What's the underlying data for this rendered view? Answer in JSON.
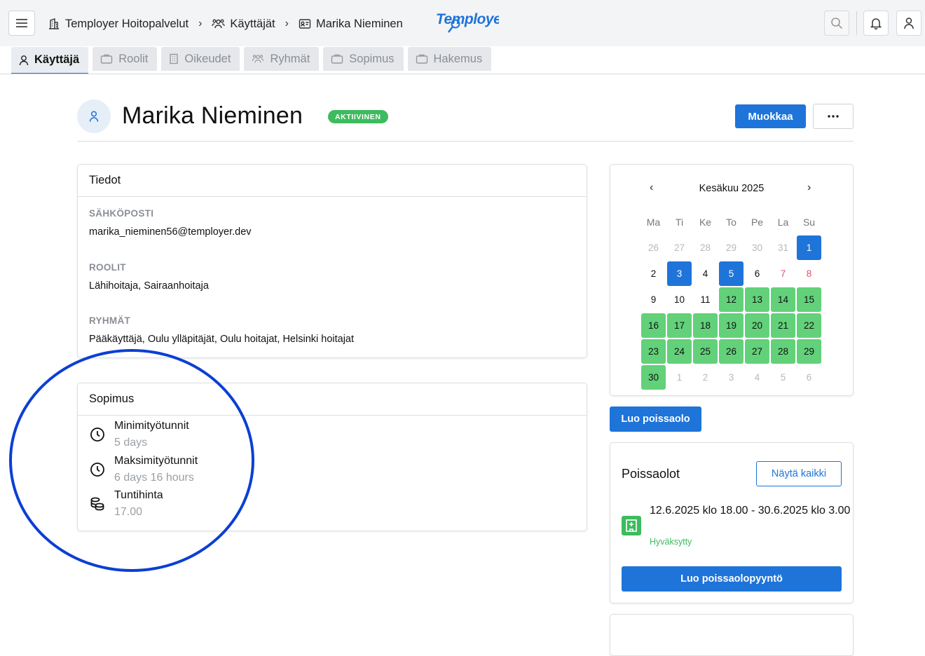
{
  "header": {
    "breadcrumbs": [
      "Temployer Hoitopalvelut",
      "Käyttäjät",
      "Marika Nieminen"
    ],
    "logo_text": "Temployer"
  },
  "tabs": [
    {
      "label": "Käyttäjä",
      "active": true
    },
    {
      "label": "Roolit"
    },
    {
      "label": "Oikeudet"
    },
    {
      "label": "Ryhmät"
    },
    {
      "label": "Sopimus"
    },
    {
      "label": "Hakemus"
    }
  ],
  "profile": {
    "name": "Marika Nieminen",
    "status": "AKTIIVINEN",
    "edit_label": "Muokkaa",
    "more_label": "···"
  },
  "tiedot": {
    "title": "Tiedot",
    "fields": [
      {
        "label": "SÄHKÖPOSTI",
        "value": "marika_nieminen56@temployer.dev"
      },
      {
        "label": "ROOLIT",
        "value": "Lähihoitaja, Sairaanhoitaja"
      },
      {
        "label": "RYHMÄT",
        "value": "Pääkäyttäjä, Oulu ylläpitäjät, Oulu hoitajat, Helsinki hoitajat"
      }
    ]
  },
  "sopimus": {
    "title": "Sopimus",
    "rows": [
      {
        "title": "Minimityötunnit",
        "value": "5 days",
        "icon": "clock-icon"
      },
      {
        "title": "Maksimityötunnit",
        "value": "6 days 16 hours",
        "icon": "clock-icon"
      },
      {
        "title": "Tuntihinta",
        "value": "17.00",
        "icon": "coins-icon"
      }
    ]
  },
  "calendar": {
    "month": "Kesäkuu 2025",
    "prev": "‹",
    "next": "›",
    "weekdays": [
      "Ma",
      "Ti",
      "Ke",
      "To",
      "Pe",
      "La",
      "Su"
    ],
    "days": [
      {
        "d": "26",
        "t": "out"
      },
      {
        "d": "27",
        "t": "out"
      },
      {
        "d": "28",
        "t": "out"
      },
      {
        "d": "29",
        "t": "out"
      },
      {
        "d": "30",
        "t": "out"
      },
      {
        "d": "31",
        "t": "out"
      },
      {
        "d": "1",
        "t": "sel"
      },
      {
        "d": "2",
        "t": ""
      },
      {
        "d": "3",
        "t": "sel"
      },
      {
        "d": "4",
        "t": ""
      },
      {
        "d": "5",
        "t": "sel"
      },
      {
        "d": "6",
        "t": ""
      },
      {
        "d": "7",
        "t": "red"
      },
      {
        "d": "8",
        "t": "red"
      },
      {
        "d": "9",
        "t": ""
      },
      {
        "d": "10",
        "t": ""
      },
      {
        "d": "11",
        "t": ""
      },
      {
        "d": "12",
        "t": "green"
      },
      {
        "d": "13",
        "t": "green"
      },
      {
        "d": "14",
        "t": "green"
      },
      {
        "d": "15",
        "t": "green"
      },
      {
        "d": "16",
        "t": "green"
      },
      {
        "d": "17",
        "t": "green"
      },
      {
        "d": "18",
        "t": "green"
      },
      {
        "d": "19",
        "t": "green"
      },
      {
        "d": "20",
        "t": "green"
      },
      {
        "d": "21",
        "t": "green"
      },
      {
        "d": "22",
        "t": "green"
      },
      {
        "d": "23",
        "t": "green"
      },
      {
        "d": "24",
        "t": "green"
      },
      {
        "d": "25",
        "t": "green"
      },
      {
        "d": "26",
        "t": "green"
      },
      {
        "d": "27",
        "t": "green"
      },
      {
        "d": "28",
        "t": "green"
      },
      {
        "d": "29",
        "t": "green"
      },
      {
        "d": "30",
        "t": "green"
      },
      {
        "d": "1",
        "t": "out"
      },
      {
        "d": "2",
        "t": "out"
      },
      {
        "d": "3",
        "t": "out"
      },
      {
        "d": "4",
        "t": "out"
      },
      {
        "d": "5",
        "t": "out"
      },
      {
        "d": "6",
        "t": "out"
      }
    ]
  },
  "absence": {
    "create_label": "Luo poissaolo",
    "title": "Poissaolot",
    "show_all_label": "Näytä kaikki",
    "entry": {
      "dates": "12.6.2025 klo 18.00 - 30.6.2025 klo 3.00",
      "status": "Hyväksytty"
    },
    "request_label": "Luo poissaolopyyntö"
  },
  "colors": {
    "primary": "#1e74d9",
    "green": "#62d17a",
    "status_green": "#3dbb5e",
    "annotation": "#0b3fd4"
  }
}
